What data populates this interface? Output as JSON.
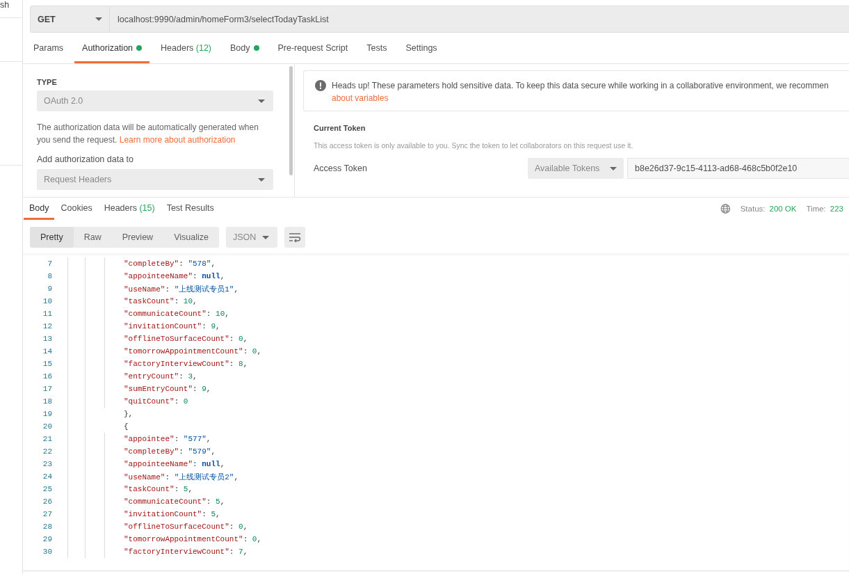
{
  "sidebar": {
    "title": "sh"
  },
  "request": {
    "method": "GET",
    "url": "localhost:9990/admin/homeForm3/selectTodayTaskList"
  },
  "request_tabs": [
    {
      "label": "Params",
      "selected": false,
      "dot": false
    },
    {
      "label": "Authorization",
      "selected": true,
      "dot": true
    },
    {
      "label": "Headers",
      "count": "(12)",
      "selected": false,
      "dot": false
    },
    {
      "label": "Body",
      "selected": false,
      "dot": true
    },
    {
      "label": "Pre-request Script",
      "selected": false,
      "dot": false
    },
    {
      "label": "Tests",
      "selected": false,
      "dot": false
    },
    {
      "label": "Settings",
      "selected": false,
      "dot": false
    }
  ],
  "authorization": {
    "type_label": "TYPE",
    "type_value": "OAuth 2.0",
    "description": "The authorization data will be automatically generated when you send the request.",
    "learn_link": "Learn more about authorization",
    "add_to_label": "Add authorization data to",
    "add_to_value": "Request Headers",
    "notice": {
      "text": "Heads up! These parameters hold sensitive data. To keep this data secure while working in a collaborative environment, we recommen",
      "link": "about variables"
    },
    "current_token": {
      "title": "Current Token",
      "description": "This access token is only available to you. Sync the token to let collaborators on this request use it.",
      "access_token_label": "Access Token",
      "tokens_dropdown": "Available Tokens",
      "access_token_value": "b8e26d37-9c15-4113-ad68-468c5b0f2e10"
    }
  },
  "response_tabs": [
    {
      "label": "Body",
      "selected": true
    },
    {
      "label": "Cookies",
      "selected": false
    },
    {
      "label": "Headers",
      "count": "(15)",
      "selected": false
    },
    {
      "label": "Test Results",
      "selected": false
    }
  ],
  "response_status": {
    "status_label": "Status:",
    "status_value": "200 OK",
    "time_label": "Time:",
    "time_value": "223"
  },
  "view_modes": [
    {
      "label": "Pretty",
      "selected": true
    },
    {
      "label": "Raw",
      "selected": false
    },
    {
      "label": "Preview",
      "selected": false
    },
    {
      "label": "Visualize",
      "selected": false
    }
  ],
  "format": "JSON",
  "code_lines": [
    {
      "number": "7",
      "kind": "member",
      "tokens": [
        {
          "kind": "key",
          "text": "\"completeBy\""
        },
        {
          "kind": "punct",
          "text": ": "
        },
        {
          "kind": "string",
          "text": "\"578\""
        },
        {
          "kind": "punct",
          "text": ","
        }
      ]
    },
    {
      "number": "8",
      "kind": "member",
      "tokens": [
        {
          "kind": "key",
          "text": "\"appointeeName\""
        },
        {
          "kind": "punct",
          "text": ": "
        },
        {
          "kind": "null",
          "text": "null"
        },
        {
          "kind": "punct",
          "text": ","
        }
      ]
    },
    {
      "number": "9",
      "kind": "member",
      "tokens": [
        {
          "kind": "key",
          "text": "\"useName\""
        },
        {
          "kind": "punct",
          "text": ": "
        },
        {
          "kind": "string",
          "text": "\"上线测试专员1\""
        },
        {
          "kind": "punct",
          "text": ","
        }
      ]
    },
    {
      "number": "10",
      "kind": "member",
      "tokens": [
        {
          "kind": "key",
          "text": "\"taskCount\""
        },
        {
          "kind": "punct",
          "text": ": "
        },
        {
          "kind": "number",
          "text": "10"
        },
        {
          "kind": "punct",
          "text": ","
        }
      ]
    },
    {
      "number": "11",
      "kind": "member",
      "tokens": [
        {
          "kind": "key",
          "text": "\"communicateCount\""
        },
        {
          "kind": "punct",
          "text": ": "
        },
        {
          "kind": "number",
          "text": "10"
        },
        {
          "kind": "punct",
          "text": ","
        }
      ]
    },
    {
      "number": "12",
      "kind": "member",
      "tokens": [
        {
          "kind": "key",
          "text": "\"invitationCount\""
        },
        {
          "kind": "punct",
          "text": ": "
        },
        {
          "kind": "number",
          "text": "9"
        },
        {
          "kind": "punct",
          "text": ","
        }
      ]
    },
    {
      "number": "13",
      "kind": "member",
      "tokens": [
        {
          "kind": "key",
          "text": "\"offlineToSurfaceCount\""
        },
        {
          "kind": "punct",
          "text": ": "
        },
        {
          "kind": "number",
          "text": "0"
        },
        {
          "kind": "punct",
          "text": ","
        }
      ]
    },
    {
      "number": "14",
      "kind": "member",
      "tokens": [
        {
          "kind": "key",
          "text": "\"tomorrowAppointmentCount\""
        },
        {
          "kind": "punct",
          "text": ": "
        },
        {
          "kind": "number",
          "text": "0"
        },
        {
          "kind": "punct",
          "text": ","
        }
      ]
    },
    {
      "number": "15",
      "kind": "member",
      "tokens": [
        {
          "kind": "key",
          "text": "\"factoryInterviewCount\""
        },
        {
          "kind": "punct",
          "text": ": "
        },
        {
          "kind": "number",
          "text": "8"
        },
        {
          "kind": "punct",
          "text": ","
        }
      ]
    },
    {
      "number": "16",
      "kind": "member",
      "tokens": [
        {
          "kind": "key",
          "text": "\"entryCount\""
        },
        {
          "kind": "punct",
          "text": ": "
        },
        {
          "kind": "number",
          "text": "3"
        },
        {
          "kind": "punct",
          "text": ","
        }
      ]
    },
    {
      "number": "17",
      "kind": "member",
      "tokens": [
        {
          "kind": "key",
          "text": "\"sumEntryCount\""
        },
        {
          "kind": "punct",
          "text": ": "
        },
        {
          "kind": "number",
          "text": "9"
        },
        {
          "kind": "punct",
          "text": ","
        }
      ]
    },
    {
      "number": "18",
      "kind": "member",
      "tokens": [
        {
          "kind": "key",
          "text": "\"quitCount\""
        },
        {
          "kind": "punct",
          "text": ": "
        },
        {
          "kind": "number",
          "text": "0"
        }
      ]
    },
    {
      "number": "19",
      "kind": "brace",
      "tokens": [
        {
          "kind": "punct",
          "text": "},"
        }
      ]
    },
    {
      "number": "20",
      "kind": "brace",
      "tokens": [
        {
          "kind": "punct",
          "text": "{"
        }
      ]
    },
    {
      "number": "21",
      "kind": "member",
      "tokens": [
        {
          "kind": "key",
          "text": "\"appointee\""
        },
        {
          "kind": "punct",
          "text": ": "
        },
        {
          "kind": "string",
          "text": "\"577\""
        },
        {
          "kind": "punct",
          "text": ","
        }
      ]
    },
    {
      "number": "22",
      "kind": "member",
      "tokens": [
        {
          "kind": "key",
          "text": "\"completeBy\""
        },
        {
          "kind": "punct",
          "text": ": "
        },
        {
          "kind": "string",
          "text": "\"579\""
        },
        {
          "kind": "punct",
          "text": ","
        }
      ]
    },
    {
      "number": "23",
      "kind": "member",
      "tokens": [
        {
          "kind": "key",
          "text": "\"appointeeName\""
        },
        {
          "kind": "punct",
          "text": ": "
        },
        {
          "kind": "null",
          "text": "null"
        },
        {
          "kind": "punct",
          "text": ","
        }
      ]
    },
    {
      "number": "24",
      "kind": "member",
      "tokens": [
        {
          "kind": "key",
          "text": "\"useName\""
        },
        {
          "kind": "punct",
          "text": ": "
        },
        {
          "kind": "string",
          "text": "\"上线测试专员2\""
        },
        {
          "kind": "punct",
          "text": ","
        }
      ]
    },
    {
      "number": "25",
      "kind": "member",
      "tokens": [
        {
          "kind": "key",
          "text": "\"taskCount\""
        },
        {
          "kind": "punct",
          "text": ": "
        },
        {
          "kind": "number",
          "text": "5"
        },
        {
          "kind": "punct",
          "text": ","
        }
      ]
    },
    {
      "number": "26",
      "kind": "member",
      "tokens": [
        {
          "kind": "key",
          "text": "\"communicateCount\""
        },
        {
          "kind": "punct",
          "text": ": "
        },
        {
          "kind": "number",
          "text": "5"
        },
        {
          "kind": "punct",
          "text": ","
        }
      ]
    },
    {
      "number": "27",
      "kind": "member",
      "tokens": [
        {
          "kind": "key",
          "text": "\"invitationCount\""
        },
        {
          "kind": "punct",
          "text": ": "
        },
        {
          "kind": "number",
          "text": "5"
        },
        {
          "kind": "punct",
          "text": ","
        }
      ]
    },
    {
      "number": "28",
      "kind": "member",
      "tokens": [
        {
          "kind": "key",
          "text": "\"offlineToSurfaceCount\""
        },
        {
          "kind": "punct",
          "text": ": "
        },
        {
          "kind": "number",
          "text": "0"
        },
        {
          "kind": "punct",
          "text": ","
        }
      ]
    },
    {
      "number": "29",
      "kind": "member",
      "tokens": [
        {
          "kind": "key",
          "text": "\"tomorrowAppointmentCount\""
        },
        {
          "kind": "punct",
          "text": ": "
        },
        {
          "kind": "number",
          "text": "0"
        },
        {
          "kind": "punct",
          "text": ","
        }
      ]
    },
    {
      "number": "30",
      "kind": "member",
      "tokens": [
        {
          "kind": "key",
          "text": "\"factoryInterviewCount\""
        },
        {
          "kind": "punct",
          "text": ": "
        },
        {
          "kind": "number",
          "text": "7"
        },
        {
          "kind": "punct",
          "text": ","
        }
      ]
    }
  ]
}
